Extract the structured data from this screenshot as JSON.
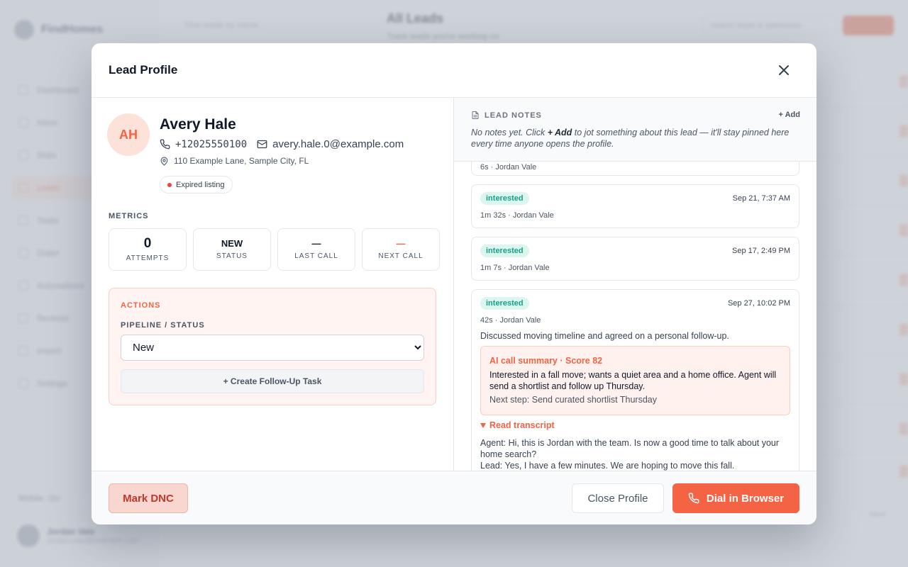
{
  "background": {
    "brand": "FindHomes",
    "nav_items": [
      "Dashboard",
      "Inbox",
      "Stats",
      "Leads",
      "Tasks",
      "Dialer",
      "Automations",
      "Reviews",
      "Import",
      "Settings"
    ],
    "mobile_label": "Mobile: On",
    "user_name": "Jordan Vale",
    "user_email": "jordan.vale@example.com",
    "search_placeholder": "Find leads by name...",
    "page_title": "All Leads",
    "page_subtitle": "Track leads you're working on",
    "filter_placeholder": "Search leads & addresses",
    "pager_label": "Next"
  },
  "modal": {
    "title": "Lead Profile",
    "close_icon": "close-icon"
  },
  "lead": {
    "initials": "AH",
    "name": "Avery Hale",
    "phone": "+12025550100",
    "email": "avery.hale.0@example.com",
    "address": "110 Example Lane, Sample City, FL",
    "tag": "Expired listing"
  },
  "metrics": {
    "label": "METRICS",
    "items": [
      {
        "value": "0",
        "label": "Attempts"
      },
      {
        "value": "NEW",
        "label": "Status"
      },
      {
        "value": "—",
        "label": "Last Call"
      },
      {
        "value": "—",
        "label": "Next Call"
      }
    ]
  },
  "actions": {
    "title": "ACTIONS",
    "pipeline_label": "PIPELINE / STATUS",
    "selected_status": "New",
    "followup_label": "+ Create Follow-Up Task"
  },
  "notes": {
    "title": "LEAD NOTES",
    "add_label": "+ Add",
    "empty_prefix": "No notes yet. Click ",
    "empty_add": "+ Add",
    "empty_suffix": " to jot something about this lead — it'll stay pinned here every time anyone opens the profile."
  },
  "calls": [
    {
      "status": "",
      "date": "",
      "meta": "6s   · Jordan Vale"
    },
    {
      "status": "interested",
      "date": "Sep 21, 7:37 AM",
      "meta": "1m 32s   · Jordan Vale"
    },
    {
      "status": "interested",
      "date": "Sep 17, 2:49 PM",
      "meta": "1m 7s   · Jordan Vale"
    },
    {
      "status": "interested",
      "date": "Sep 27, 10:02 PM",
      "meta": "42s   · Jordan Vale",
      "note": "Discussed moving timeline and agreed on a personal follow-up.",
      "ai_title": "AI call summary · Score 82",
      "ai_summary": "Interested in a fall move; wants a quiet area and a home office. Agent will send a shortlist and follow up Thursday.",
      "ai_next": "Next step: Send curated shortlist Thursday",
      "transcript_toggle": "Read transcript",
      "transcript": [
        "Agent: Hi, this is Jordan with the team. Is now a good time to talk about your home search?",
        "Lead: Yes, I have a few minutes. We are hoping to move this fall."
      ]
    }
  ],
  "footer": {
    "dnc_label": "Mark DNC",
    "close_label": "Close Profile",
    "dial_label": "Dial in Browser"
  },
  "colors": {
    "accent": "#f46343",
    "interested": "#14a18a"
  }
}
